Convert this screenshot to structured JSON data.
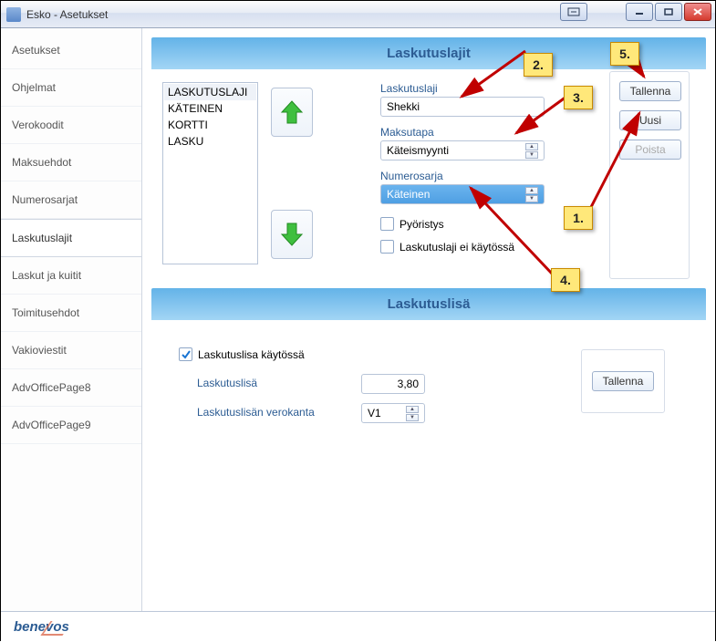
{
  "window": {
    "title": "Esko - Asetukset"
  },
  "sidebar": {
    "items": [
      {
        "label": "Asetukset"
      },
      {
        "label": "Ohjelmat"
      },
      {
        "label": "Verokoodit"
      },
      {
        "label": "Maksuehdot"
      },
      {
        "label": "Numerosarjat"
      },
      {
        "label": "Laskutuslajit"
      },
      {
        "label": "Laskut ja kuitit"
      },
      {
        "label": "Toimitusehdot"
      },
      {
        "label": "Vakioviestit"
      },
      {
        "label": "AdvOfficePage8"
      },
      {
        "label": "AdvOfficePage9"
      }
    ],
    "active_index": 5
  },
  "section1": {
    "header": "Laskutuslajit",
    "list": [
      "LASKUTUSLAJI",
      "KÄTEINEN",
      "KORTTI",
      "LASKU"
    ],
    "list_selected_index": 0,
    "fields": {
      "laskutuslaji_label": "Laskutuslaji",
      "laskutuslaji_value": "Shekki",
      "maksutapa_label": "Maksutapa",
      "maksutapa_value": "Käteismyynti",
      "numerosarja_label": "Numerosarja",
      "numerosarja_value": "Käteinen",
      "pyoristys_label": "Pyöristys",
      "ei_kaytossa_label": "Laskutuslaji ei käytössä"
    },
    "buttons": {
      "tallenna": "Tallenna",
      "uusi": "Uusi",
      "poista": "Poista"
    }
  },
  "section2": {
    "header": "Laskutuslisä",
    "enabled_label": "Laskutuslisa käytössä",
    "enabled_checked": true,
    "lisa_label": "Laskutuslisä",
    "lisa_value": "3,80",
    "verokanta_label": "Laskutuslisän verokanta",
    "verokanta_value": "V1",
    "tallenna": "Tallenna"
  },
  "footer": {
    "brand": "benevos"
  },
  "annotations": {
    "n1": "1.",
    "n2": "2.",
    "n3": "3.",
    "n4": "4.",
    "n5": "5."
  }
}
